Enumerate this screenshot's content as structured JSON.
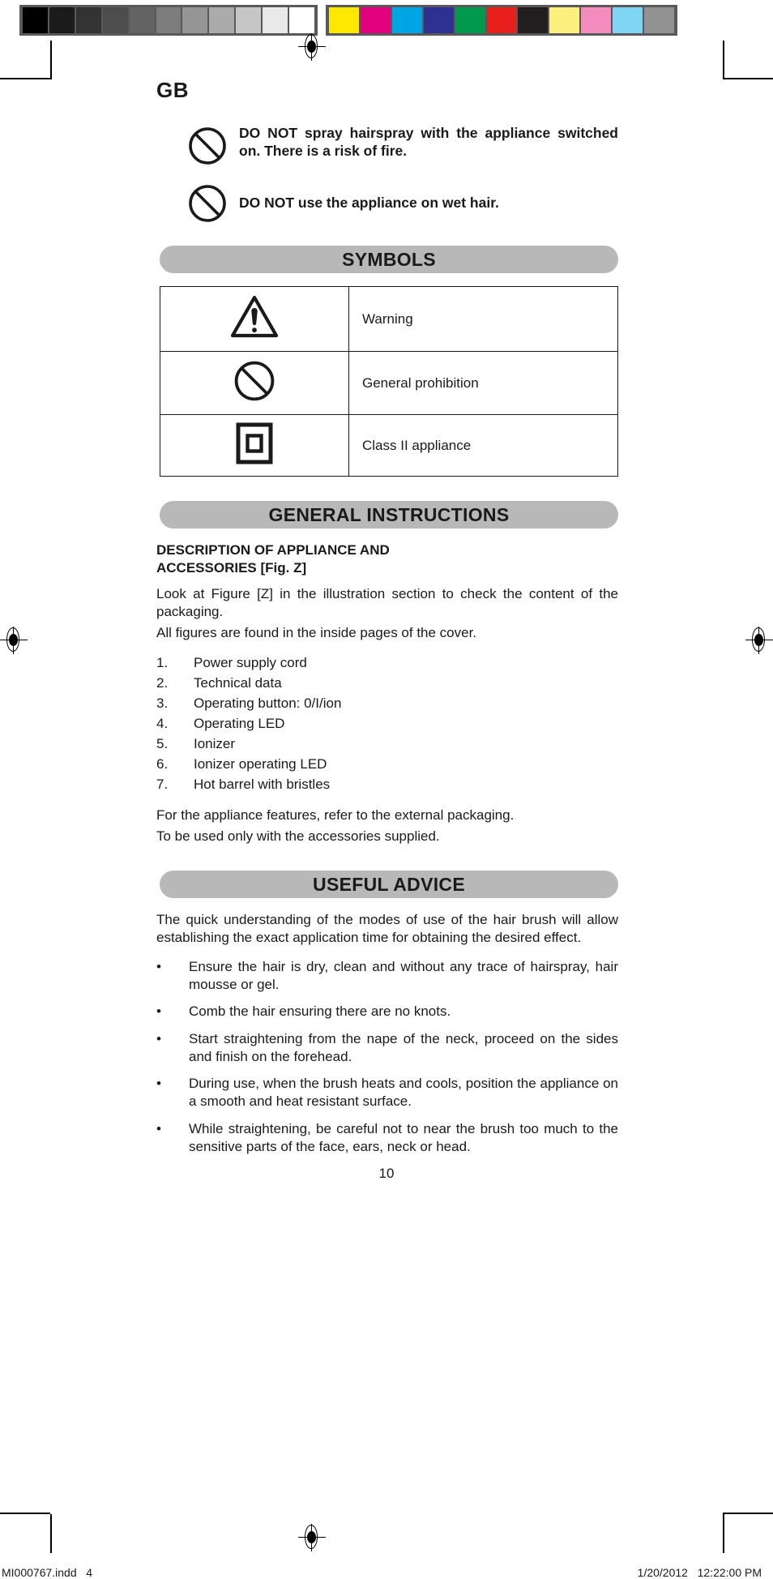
{
  "calibration": {
    "grayscale_swatches": [
      "#000000",
      "#1b1b1b",
      "#333333",
      "#4d4d4d",
      "#636363",
      "#7d7d7d",
      "#959595",
      "#ababab",
      "#c6c6c6",
      "#e9e9e9",
      "#ffffff"
    ],
    "color_swatches": [
      "#ffe800",
      "#e3007f",
      "#00a5e3",
      "#2e3192",
      "#00994d",
      "#e8201c",
      "#231f20",
      "#fdf07f",
      "#f48bbf",
      "#7fd6f4",
      "#929292"
    ],
    "strip_background": "#59595b"
  },
  "page": {
    "language_code": "GB",
    "page_number": "10"
  },
  "notices": [
    {
      "icon": "prohibition-icon",
      "text": "DO NOT spray hairspray with the appliance switched on. There is a risk of fire."
    },
    {
      "icon": "prohibition-icon",
      "text": "DO NOT use the appliance on wet hair."
    }
  ],
  "symbols_section": {
    "heading": "SYMBOLS",
    "rows": [
      {
        "icon": "warning-triangle-icon",
        "label": "Warning"
      },
      {
        "icon": "prohibition-icon",
        "label": "General prohibition"
      },
      {
        "icon": "class-two-square-icon",
        "label": "Class II appliance"
      }
    ]
  },
  "general_instructions": {
    "heading": "GENERAL INSTRUCTIONS",
    "sub_heading_line1": "DESCRIPTION OF APPLIANCE AND",
    "sub_heading_line2": "ACCESSORIES [Fig. Z]",
    "intro_paragraph": "Look at Figure [Z] in the illustration section to check the content of the packaging.",
    "intro_paragraph_2": "All figures are found in the inside pages of the cover.",
    "parts": [
      {
        "num": "1.",
        "label": "Power supply cord"
      },
      {
        "num": "2.",
        "label": "Technical data"
      },
      {
        "num": "3.",
        "label": "Operating button: 0/I/ion"
      },
      {
        "num": "4.",
        "label": "Operating LED"
      },
      {
        "num": "5.",
        "label": "Ionizer"
      },
      {
        "num": "6.",
        "label": "Ionizer operating LED"
      },
      {
        "num": "7.",
        "label": "Hot barrel with bristles"
      }
    ],
    "closing_line1": "For the appliance features, refer to the external packaging.",
    "closing_line2": "To be used only with the accessories supplied."
  },
  "useful_advice": {
    "heading": "USEFUL ADVICE",
    "intro": "The quick understanding of the modes of use of the hair brush will allow establishing the exact application time for obtaining the desired effect.",
    "bullet_char": "•",
    "bullets": [
      "Ensure the hair is dry, clean and without any trace of hairspray, hair mousse or gel.",
      "Comb the hair ensuring there are no knots.",
      "Start straightening from the nape of the neck, proceed on the sides and finish on the forehead.",
      "During use, when the brush heats and cools, position the appliance on a smooth and heat resistant surface.",
      "While straightening, be careful not to near the brush too much to the sensitive parts of the face, ears, neck or head."
    ]
  },
  "footer": {
    "file_name": "MI000767.indd   4",
    "timestamp": "1/20/2012   12:22:00 PM"
  }
}
